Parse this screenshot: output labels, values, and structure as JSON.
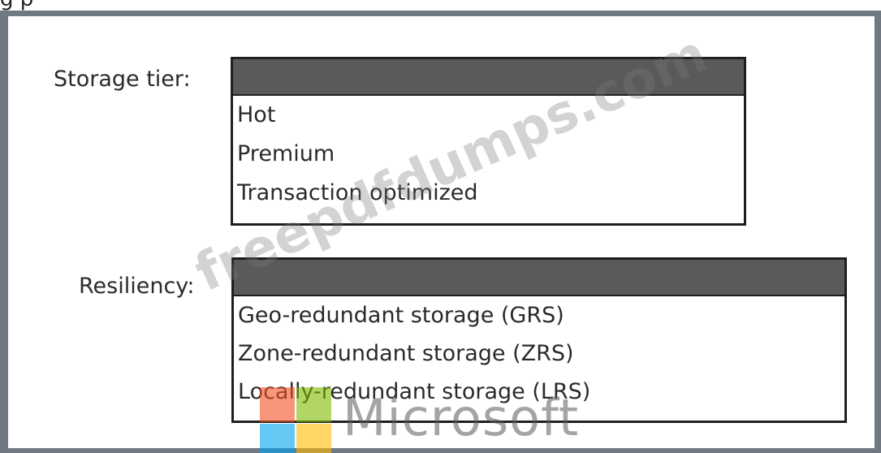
{
  "top_cut_text": "g                                                                                    p",
  "storage_tier": {
    "label": "Storage tier:",
    "options": [
      "Hot",
      "Premium",
      "Transaction optimized"
    ]
  },
  "resiliency": {
    "label": "Resiliency:",
    "options": [
      "Geo-redundant storage (GRS)",
      "Zone-redundant storage (ZRS)",
      "Locally-redundant storage (LRS)"
    ]
  },
  "watermark": "freepdfdumps.com",
  "logo": {
    "word": "Microsoft",
    "colors": [
      "#f25022",
      "#7fba00",
      "#00a4ef",
      "#ffb900"
    ]
  },
  "colors": {
    "frame": "#6f7883",
    "dropdown_header": "#5a5a5a",
    "dropdown_border": "#1f1f1f"
  }
}
